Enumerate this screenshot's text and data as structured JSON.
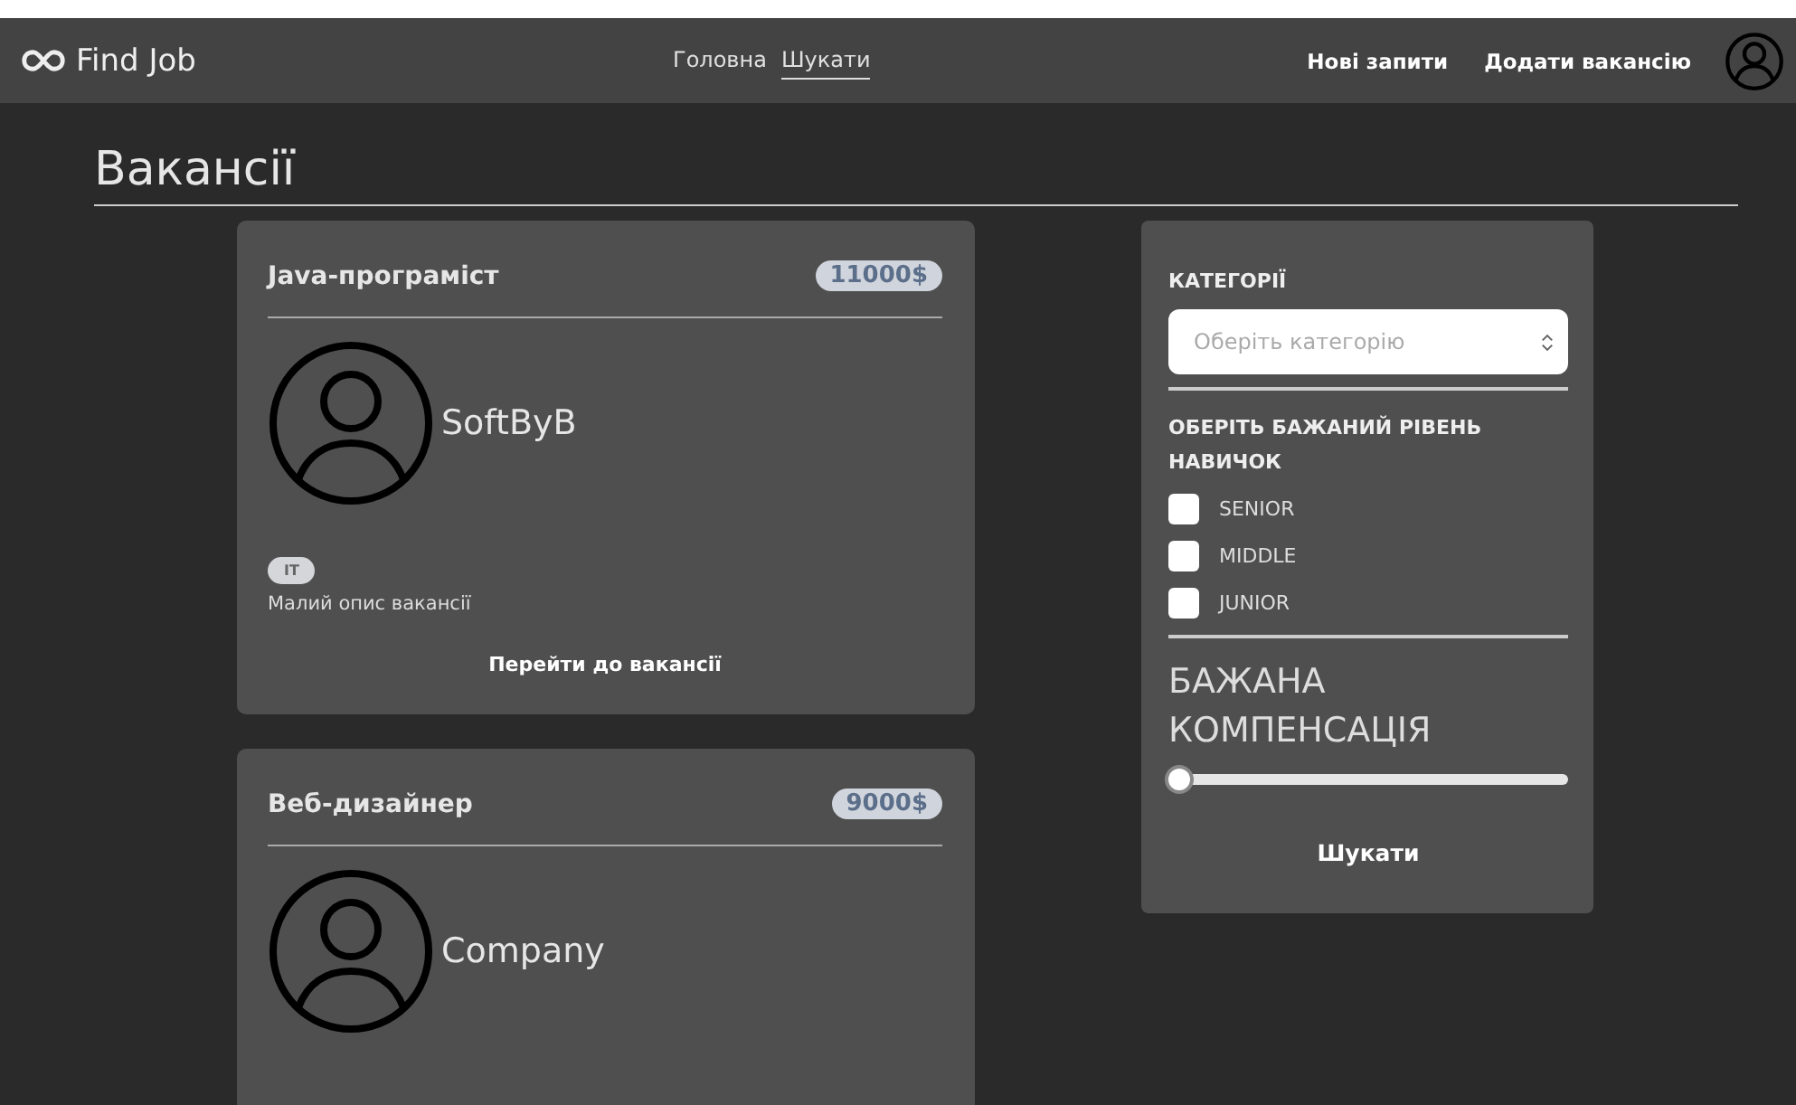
{
  "navbar": {
    "brand": "Find Job",
    "links": [
      {
        "label": "Головна",
        "selected": false
      },
      {
        "label": "Шукати",
        "selected": true
      }
    ],
    "actions": [
      "Нові запити",
      "Додати вакансію"
    ]
  },
  "page_title": "Вакансії",
  "vacancies": [
    {
      "title": "Java-програміст",
      "salary": "11000$",
      "company": "SoftByB",
      "tags": [
        "IT"
      ],
      "description": "Малий опис вакансії",
      "link": "Перейти до вакансії"
    },
    {
      "title": "Веб-дизайнер",
      "salary": "9000$",
      "company": "Company"
    }
  ],
  "filters": {
    "category_label": "КАТЕГОРІЇ",
    "category_placeholder": "Оберіть категорію",
    "level_label": "ОБЕРІТЬ БАЖАНИЙ РІВЕНЬ НАВИЧОК",
    "levels": [
      {
        "label": "SENIOR",
        "checked": false
      },
      {
        "label": "MIDDLE",
        "checked": false
      },
      {
        "label": "JUNIOR",
        "checked": false
      }
    ],
    "compensation_label": "БАЖАНА КОМПЕНСАЦІЯ",
    "compensation": {
      "level": 0
    },
    "search_button": "Шукати"
  }
}
